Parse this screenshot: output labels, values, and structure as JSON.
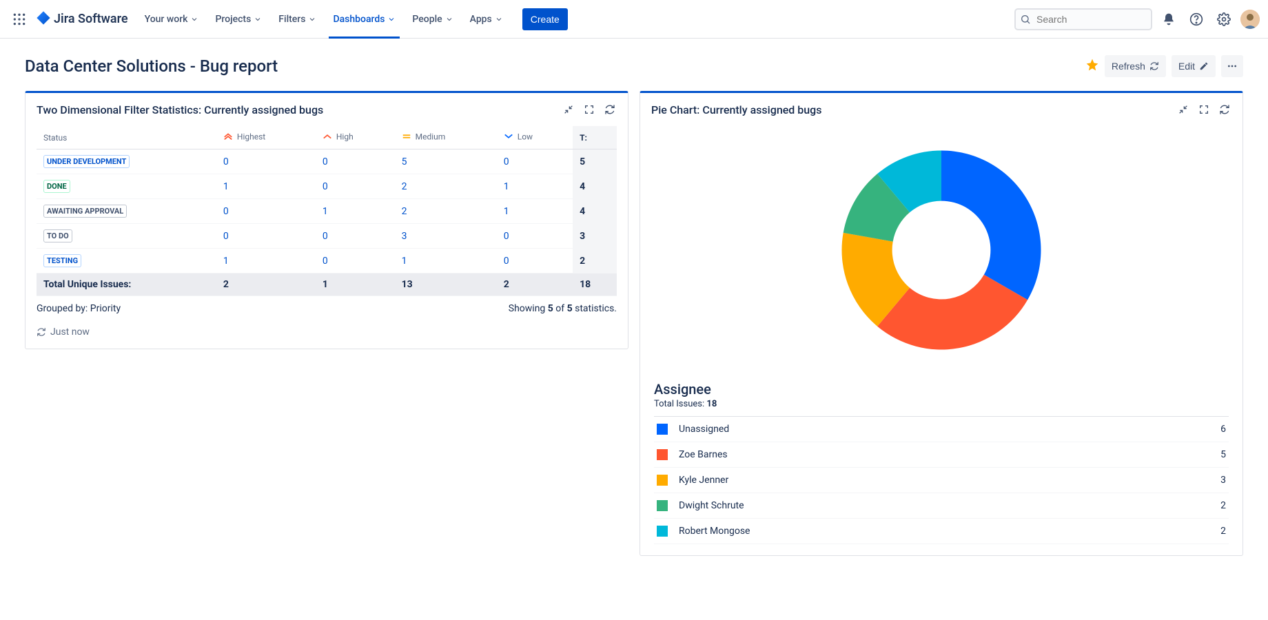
{
  "nav": {
    "product": "Jira Software",
    "items": [
      {
        "label": "Your work"
      },
      {
        "label": "Projects"
      },
      {
        "label": "Filters"
      },
      {
        "label": "Dashboards",
        "active": true
      },
      {
        "label": "People"
      },
      {
        "label": "Apps"
      }
    ],
    "create": "Create",
    "search_placeholder": "Search"
  },
  "page": {
    "title": "Data Center Solutions - Bug report",
    "refresh": "Refresh",
    "edit": "Edit"
  },
  "stats_gadget": {
    "title": "Two Dimensional Filter Statistics: Currently assigned bugs",
    "columns": {
      "status": "Status",
      "highest": "Highest",
      "high": "High",
      "medium": "Medium",
      "low": "Low",
      "total": "T:"
    },
    "rows": [
      {
        "status": "UNDER DEVELOPMENT",
        "loz": "loz-blue",
        "highest": 0,
        "high": 0,
        "medium": 5,
        "low": 0,
        "total": 5
      },
      {
        "status": "DONE",
        "loz": "loz-green",
        "highest": 1,
        "high": 0,
        "medium": 2,
        "low": 1,
        "total": 4
      },
      {
        "status": "AWAITING APPROVAL",
        "loz": "loz-gray",
        "highest": 0,
        "high": 1,
        "medium": 2,
        "low": 1,
        "total": 4
      },
      {
        "status": "TO DO",
        "loz": "loz-gray",
        "highest": 0,
        "high": 0,
        "medium": 3,
        "low": 0,
        "total": 3
      },
      {
        "status": "TESTING",
        "loz": "loz-blue",
        "highest": 1,
        "high": 0,
        "medium": 1,
        "low": 0,
        "total": 2
      }
    ],
    "totals": {
      "label": "Total Unique Issues:",
      "highest": 2,
      "high": 1,
      "medium": 13,
      "low": 2,
      "total": 18
    },
    "grouped_by_label": "Grouped by: ",
    "grouped_by_value": "Priority",
    "showing_prefix": "Showing ",
    "showing_of": " of ",
    "showing_suffix": " statistics.",
    "showing_a": "5",
    "showing_b": "5",
    "just_now": "Just now"
  },
  "pie_gadget": {
    "title": "Pie Chart: Currently assigned bugs",
    "legend_title": "Assignee",
    "total_label": "Total Issues: ",
    "total_value": "18"
  },
  "chart_data": {
    "type": "pie",
    "title": "Currently assigned bugs",
    "total": 18,
    "series": [
      {
        "name": "Unassigned",
        "value": 6,
        "color": "#0065FF"
      },
      {
        "name": "Zoe Barnes",
        "value": 5,
        "color": "#FF5630"
      },
      {
        "name": "Kyle Jenner",
        "value": 3,
        "color": "#FFAB00"
      },
      {
        "name": "Dwight Schrute",
        "value": 2,
        "color": "#36B37E"
      },
      {
        "name": "Robert Mongose",
        "value": 2,
        "color": "#00B8D9"
      }
    ]
  }
}
